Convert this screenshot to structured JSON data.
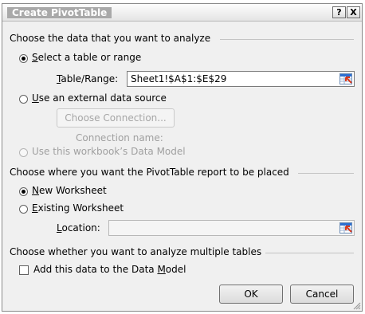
{
  "dialog": {
    "title": "Create PivotTable",
    "help_button": "?",
    "close_button": "X"
  },
  "section1": {
    "heading": "Choose the data that you want to analyze",
    "option_table": {
      "accel": "S",
      "rest": "elect a table or range",
      "selected": true
    },
    "table_range": {
      "accel": "T",
      "rest": "able/Range:",
      "value": "Sheet1!$A$1:$E$29"
    },
    "option_external": {
      "accel": "U",
      "rest": "se an external data source",
      "selected": false
    },
    "choose_connection": "Choose Connection...",
    "connection_name": "Connection name:",
    "option_data_model": {
      "label": "Use this workbook’s Data Model",
      "enabled": false
    }
  },
  "section2": {
    "heading": "Choose where you want the PivotTable report to be placed",
    "option_new": {
      "accel": "N",
      "rest": "ew Worksheet",
      "selected": true
    },
    "option_existing": {
      "accel": "E",
      "rest": "xisting Worksheet",
      "selected": false
    },
    "location": {
      "accel": "L",
      "rest": "ocation:",
      "value": ""
    }
  },
  "section3": {
    "heading": "Choose whether you want to analyze multiple tables",
    "add_to_model": {
      "pre": "Add this data to the Data ",
      "accel": "M",
      "post": "odel",
      "checked": false
    }
  },
  "buttons": {
    "ok": "OK",
    "cancel": "Cancel"
  },
  "icons": {
    "range": "range-selector-icon",
    "grip": "resize-grip-icon"
  },
  "colors": {
    "dialog_bg": "#f0f0f0",
    "title_text": "#ffffff",
    "range_icon_blue": "#2d6fd1",
    "range_icon_red": "#d93a1e"
  }
}
